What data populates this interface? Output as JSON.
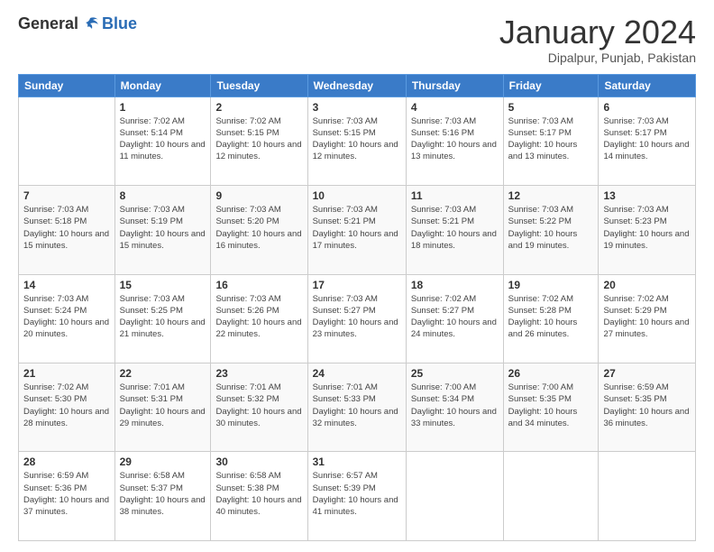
{
  "logo": {
    "general": "General",
    "blue": "Blue"
  },
  "header": {
    "title": "January 2024",
    "subtitle": "Dipalpur, Punjab, Pakistan"
  },
  "weekdays": [
    "Sunday",
    "Monday",
    "Tuesday",
    "Wednesday",
    "Thursday",
    "Friday",
    "Saturday"
  ],
  "weeks": [
    [
      {
        "day": "",
        "info": ""
      },
      {
        "day": "1",
        "info": "Sunrise: 7:02 AM\nSunset: 5:14 PM\nDaylight: 10 hours\nand 11 minutes."
      },
      {
        "day": "2",
        "info": "Sunrise: 7:02 AM\nSunset: 5:15 PM\nDaylight: 10 hours\nand 12 minutes."
      },
      {
        "day": "3",
        "info": "Sunrise: 7:03 AM\nSunset: 5:15 PM\nDaylight: 10 hours\nand 12 minutes."
      },
      {
        "day": "4",
        "info": "Sunrise: 7:03 AM\nSunset: 5:16 PM\nDaylight: 10 hours\nand 13 minutes."
      },
      {
        "day": "5",
        "info": "Sunrise: 7:03 AM\nSunset: 5:17 PM\nDaylight: 10 hours\nand 13 minutes."
      },
      {
        "day": "6",
        "info": "Sunrise: 7:03 AM\nSunset: 5:17 PM\nDaylight: 10 hours\nand 14 minutes."
      }
    ],
    [
      {
        "day": "7",
        "info": "Sunrise: 7:03 AM\nSunset: 5:18 PM\nDaylight: 10 hours\nand 15 minutes."
      },
      {
        "day": "8",
        "info": "Sunrise: 7:03 AM\nSunset: 5:19 PM\nDaylight: 10 hours\nand 15 minutes."
      },
      {
        "day": "9",
        "info": "Sunrise: 7:03 AM\nSunset: 5:20 PM\nDaylight: 10 hours\nand 16 minutes."
      },
      {
        "day": "10",
        "info": "Sunrise: 7:03 AM\nSunset: 5:21 PM\nDaylight: 10 hours\nand 17 minutes."
      },
      {
        "day": "11",
        "info": "Sunrise: 7:03 AM\nSunset: 5:21 PM\nDaylight: 10 hours\nand 18 minutes."
      },
      {
        "day": "12",
        "info": "Sunrise: 7:03 AM\nSunset: 5:22 PM\nDaylight: 10 hours\nand 19 minutes."
      },
      {
        "day": "13",
        "info": "Sunrise: 7:03 AM\nSunset: 5:23 PM\nDaylight: 10 hours\nand 19 minutes."
      }
    ],
    [
      {
        "day": "14",
        "info": "Sunrise: 7:03 AM\nSunset: 5:24 PM\nDaylight: 10 hours\nand 20 minutes."
      },
      {
        "day": "15",
        "info": "Sunrise: 7:03 AM\nSunset: 5:25 PM\nDaylight: 10 hours\nand 21 minutes."
      },
      {
        "day": "16",
        "info": "Sunrise: 7:03 AM\nSunset: 5:26 PM\nDaylight: 10 hours\nand 22 minutes."
      },
      {
        "day": "17",
        "info": "Sunrise: 7:03 AM\nSunset: 5:27 PM\nDaylight: 10 hours\nand 23 minutes."
      },
      {
        "day": "18",
        "info": "Sunrise: 7:02 AM\nSunset: 5:27 PM\nDaylight: 10 hours\nand 24 minutes."
      },
      {
        "day": "19",
        "info": "Sunrise: 7:02 AM\nSunset: 5:28 PM\nDaylight: 10 hours\nand 26 minutes."
      },
      {
        "day": "20",
        "info": "Sunrise: 7:02 AM\nSunset: 5:29 PM\nDaylight: 10 hours\nand 27 minutes."
      }
    ],
    [
      {
        "day": "21",
        "info": "Sunrise: 7:02 AM\nSunset: 5:30 PM\nDaylight: 10 hours\nand 28 minutes."
      },
      {
        "day": "22",
        "info": "Sunrise: 7:01 AM\nSunset: 5:31 PM\nDaylight: 10 hours\nand 29 minutes."
      },
      {
        "day": "23",
        "info": "Sunrise: 7:01 AM\nSunset: 5:32 PM\nDaylight: 10 hours\nand 30 minutes."
      },
      {
        "day": "24",
        "info": "Sunrise: 7:01 AM\nSunset: 5:33 PM\nDaylight: 10 hours\nand 32 minutes."
      },
      {
        "day": "25",
        "info": "Sunrise: 7:00 AM\nSunset: 5:34 PM\nDaylight: 10 hours\nand 33 minutes."
      },
      {
        "day": "26",
        "info": "Sunrise: 7:00 AM\nSunset: 5:35 PM\nDaylight: 10 hours\nand 34 minutes."
      },
      {
        "day": "27",
        "info": "Sunrise: 6:59 AM\nSunset: 5:35 PM\nDaylight: 10 hours\nand 36 minutes."
      }
    ],
    [
      {
        "day": "28",
        "info": "Sunrise: 6:59 AM\nSunset: 5:36 PM\nDaylight: 10 hours\nand 37 minutes."
      },
      {
        "day": "29",
        "info": "Sunrise: 6:58 AM\nSunset: 5:37 PM\nDaylight: 10 hours\nand 38 minutes."
      },
      {
        "day": "30",
        "info": "Sunrise: 6:58 AM\nSunset: 5:38 PM\nDaylight: 10 hours\nand 40 minutes."
      },
      {
        "day": "31",
        "info": "Sunrise: 6:57 AM\nSunset: 5:39 PM\nDaylight: 10 hours\nand 41 minutes."
      },
      {
        "day": "",
        "info": ""
      },
      {
        "day": "",
        "info": ""
      },
      {
        "day": "",
        "info": ""
      }
    ]
  ]
}
